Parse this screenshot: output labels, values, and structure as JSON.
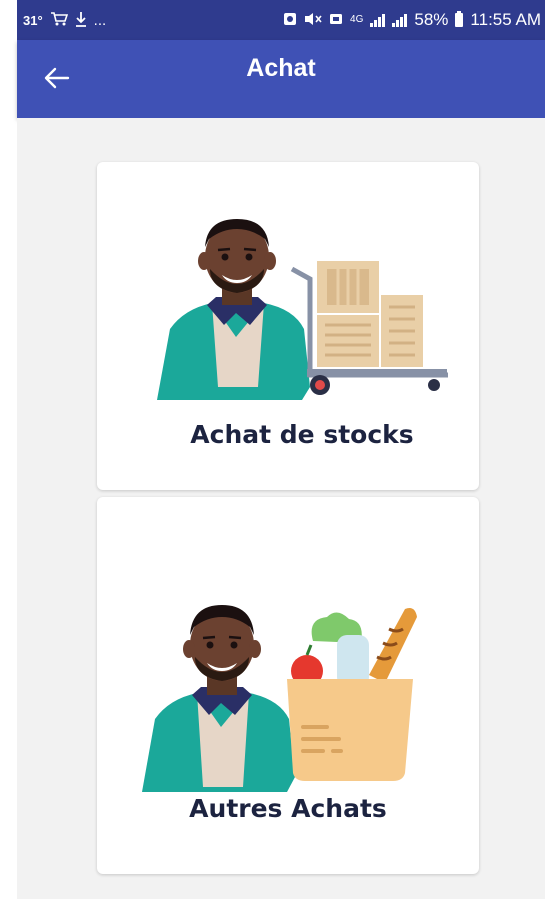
{
  "status_bar": {
    "temperature": "31°",
    "ellipsis": "...",
    "network": "4G",
    "battery_pct": "58%",
    "time": "11:55 AM",
    "icons": [
      "shopping-cart-icon",
      "download-icon",
      "notification-icon",
      "mute-icon",
      "message-icon",
      "signal-icon",
      "battery-icon"
    ]
  },
  "app_bar": {
    "title": "Achat",
    "back_icon": "arrow-left-icon",
    "color": "#3f51b5"
  },
  "options": [
    {
      "label": "Achat de stocks",
      "illustration": "man-with-stock-trolley"
    },
    {
      "label": "Autres Achats",
      "illustration": "man-with-grocery-bag"
    }
  ]
}
